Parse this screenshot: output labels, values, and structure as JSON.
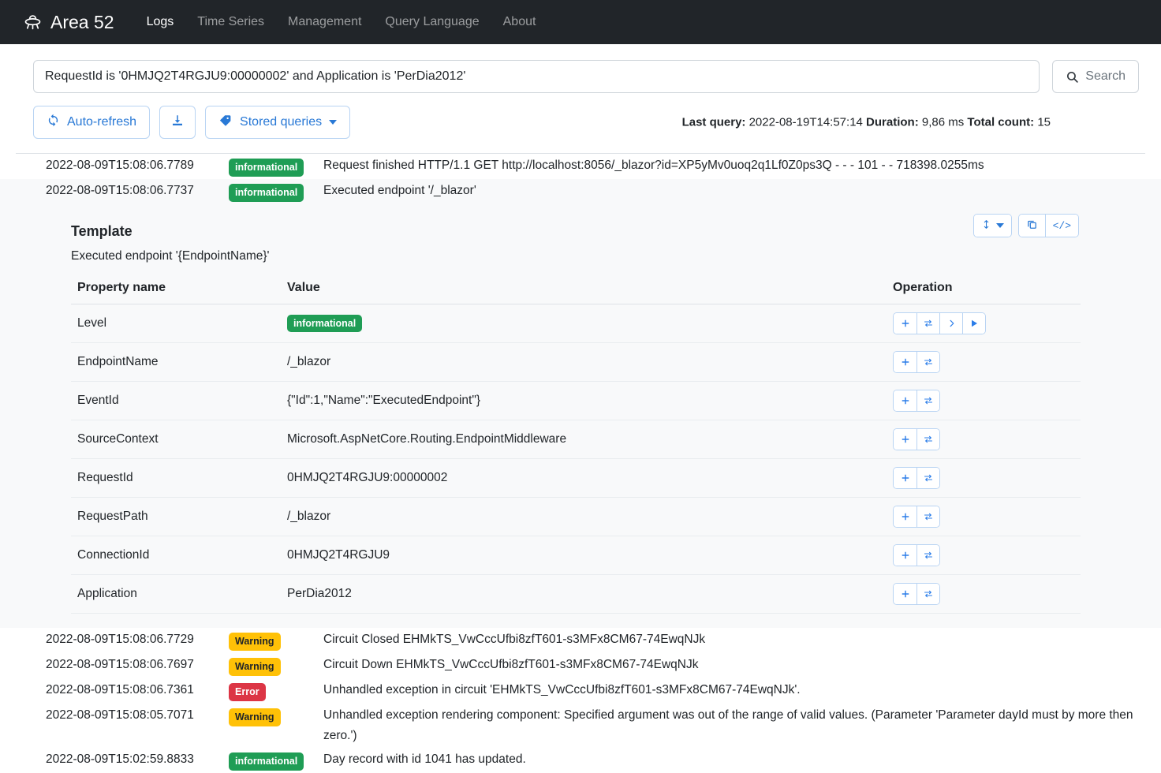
{
  "navbar": {
    "brand": "Area 52",
    "brand_icon": "ufo-icon",
    "links": [
      {
        "label": "Logs",
        "active": true
      },
      {
        "label": "Time Series",
        "active": false
      },
      {
        "label": "Management",
        "active": false
      },
      {
        "label": "Query Language",
        "active": false
      },
      {
        "label": "About",
        "active": false
      }
    ]
  },
  "search": {
    "value": "RequestId is '0HMJQ2T4RGJU9:00000002' and Application is 'PerDia2012'",
    "placeholder": "",
    "button_label": "Search",
    "button_icon": "search-icon"
  },
  "toolbar": {
    "auto_refresh_label": "Auto-refresh",
    "auto_refresh_icon": "refresh-icon",
    "download_icon": "download-icon",
    "stored_queries_label": "Stored queries",
    "stored_queries_icon": "tag-icon"
  },
  "status": {
    "last_query_label": "Last query:",
    "last_query_value": "2022-08-19T14:57:14",
    "duration_label": "Duration:",
    "duration_value": "9,86 ms",
    "total_count_label": "Total count:",
    "total_count_value": "15"
  },
  "logs_top": [
    {
      "timestamp": "2022-08-09T15:08:06.7789",
      "level": "informational",
      "message": "Request finished HTTP/1.1 GET http://localhost:8056/_blazor?id=XP5yMv0uoq2q1Lf0Z0ps3Q - - - 101 - - 718398.0255ms"
    },
    {
      "timestamp": "2022-08-09T15:08:06.7737",
      "level": "informational",
      "message": "Executed endpoint '/_blazor'"
    }
  ],
  "detail": {
    "tools": {
      "resize_icon": "height-arrows-icon",
      "resize_caret_icon": "caret-down-icon",
      "copy_icon": "copy-icon",
      "code_icon": "code-icon",
      "code_glyph": "</>"
    },
    "template_title": "Template",
    "template_text": "Executed endpoint '{EndpointName}'",
    "table": {
      "headers": [
        "Property name",
        "Value",
        "Operation"
      ],
      "rows": [
        {
          "name": "Level",
          "value": "informational",
          "is_badge": true,
          "badge_class": "informational",
          "ops": [
            "plus-icon",
            "swap-icon",
            "chevron-right-icon",
            "play-icon"
          ]
        },
        {
          "name": "EndpointName",
          "value": "/_blazor",
          "is_badge": false,
          "ops": [
            "plus-icon",
            "swap-icon"
          ]
        },
        {
          "name": "EventId",
          "value": "{\"Id\":1,\"Name\":\"ExecutedEndpoint\"}",
          "is_badge": false,
          "ops": [
            "plus-icon",
            "swap-icon"
          ]
        },
        {
          "name": "SourceContext",
          "value": "Microsoft.AspNetCore.Routing.EndpointMiddleware",
          "is_badge": false,
          "ops": [
            "plus-icon",
            "swap-icon"
          ]
        },
        {
          "name": "RequestId",
          "value": "0HMJQ2T4RGJU9:00000002",
          "is_badge": false,
          "ops": [
            "plus-icon",
            "swap-icon"
          ]
        },
        {
          "name": "RequestPath",
          "value": "/_blazor",
          "is_badge": false,
          "ops": [
            "plus-icon",
            "swap-icon"
          ]
        },
        {
          "name": "ConnectionId",
          "value": "0HMJQ2T4RGJU9",
          "is_badge": false,
          "ops": [
            "plus-icon",
            "swap-icon"
          ]
        },
        {
          "name": "Application",
          "value": "PerDia2012",
          "is_badge": false,
          "ops": [
            "plus-icon",
            "swap-icon"
          ]
        }
      ]
    }
  },
  "logs_bottom": [
    {
      "timestamp": "2022-08-09T15:08:06.7729",
      "level": "Warning",
      "badge_class": "warning",
      "message": "Circuit Closed EHMkTS_VwCccUfbi8zfT601-s3MFx8CM67-74EwqNJk"
    },
    {
      "timestamp": "2022-08-09T15:08:06.7697",
      "level": "Warning",
      "badge_class": "warning",
      "message": "Circuit Down EHMkTS_VwCccUfbi8zfT601-s3MFx8CM67-74EwqNJk"
    },
    {
      "timestamp": "2022-08-09T15:08:06.7361",
      "level": "Error",
      "badge_class": "error",
      "message": "Unhandled exception in circuit 'EHMkTS_VwCccUfbi8zfT601-s3MFx8CM67-74EwqNJk'."
    },
    {
      "timestamp": "2022-08-09T15:08:05.7071",
      "level": "Warning",
      "badge_class": "warning",
      "message": "Unhandled exception rendering component: Specified argument was out of the range of valid values. (Parameter 'Parameter dayId must by more then zero.')"
    },
    {
      "timestamp": "2022-08-09T15:02:59.8833",
      "level": "informational",
      "badge_class": "informational",
      "message": "Day record with id 1041 has updated."
    }
  ]
}
